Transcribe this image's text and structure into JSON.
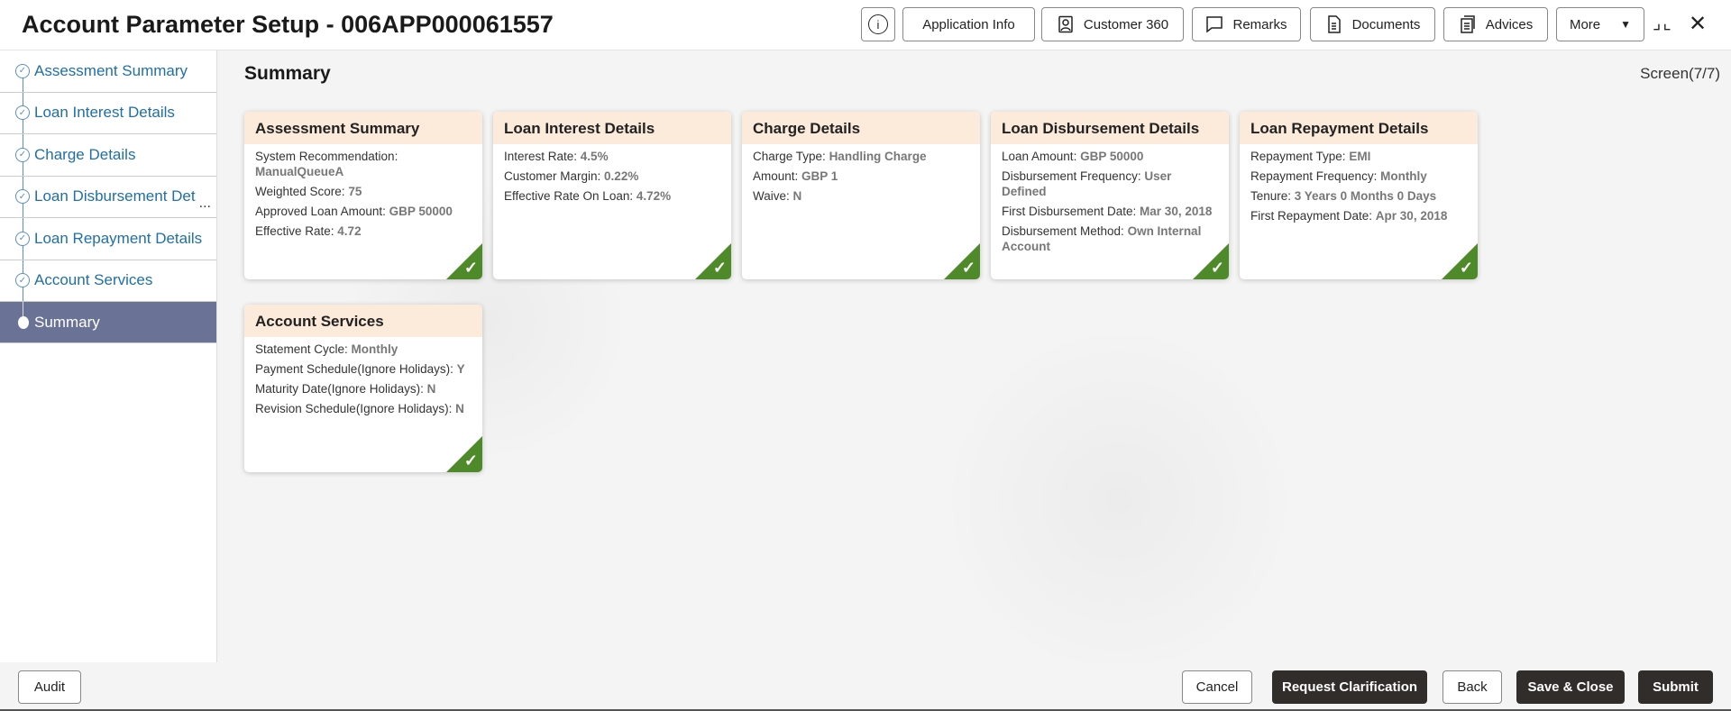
{
  "header": {
    "title": "Account Parameter Setup - 006APP000061557",
    "buttons": [
      {
        "label": "Application Info",
        "icon": "none"
      },
      {
        "label": "Customer 360",
        "icon": "user-icon"
      },
      {
        "label": "Remarks",
        "icon": "comment-icon"
      },
      {
        "label": "Documents",
        "icon": "document-icon"
      },
      {
        "label": "Advices",
        "icon": "advices-icon"
      },
      {
        "label": "More",
        "icon": "chevron-down-icon"
      }
    ]
  },
  "sidebar": {
    "items": [
      {
        "label": "Assessment Summary"
      },
      {
        "label": "Loan Interest Details"
      },
      {
        "label": "Charge Details"
      },
      {
        "label": "Loan Disbursement Det"
      },
      {
        "label": "Loan Repayment Details"
      },
      {
        "label": "Account Services"
      },
      {
        "label": "Summary",
        "active": true
      }
    ],
    "ellipsis": "..."
  },
  "main": {
    "title": "Summary",
    "screen": "Screen(7/7)",
    "cards": [
      {
        "title": "Assessment Summary",
        "rows": [
          {
            "k": "System Recommendation: ",
            "v": "ManualQueueA",
            "block": true
          },
          {
            "k": "Weighted Score: ",
            "v": "75"
          },
          {
            "k": "Approved Loan Amount: ",
            "v": "GBP 50000"
          },
          {
            "k": "Effective Rate: ",
            "v": "4.72"
          }
        ]
      },
      {
        "title": "Loan Interest Details",
        "rows": [
          {
            "k": "Interest Rate: ",
            "v": "4.5%"
          },
          {
            "k": "Customer Margin: ",
            "v": "0.22%"
          },
          {
            "k": "Effective Rate On Loan: ",
            "v": "4.72%"
          }
        ]
      },
      {
        "title": "Charge Details",
        "rows": [
          {
            "k": "Charge Type: ",
            "v": "Handling Charge"
          },
          {
            "k": "Amount: ",
            "v": "GBP 1"
          },
          {
            "k": "Waive: ",
            "v": "N"
          }
        ]
      },
      {
        "title": "Loan Disbursement Details",
        "rows": [
          {
            "k": "Loan Amount: ",
            "v": "GBP 50000"
          },
          {
            "k": "Disbursement Frequency: ",
            "v": "User Defined"
          },
          {
            "k": "First Disbursement Date: ",
            "v": "Mar 30, 2018"
          },
          {
            "k": "Disbursement Method: ",
            "v": "Own Internal Account"
          }
        ]
      },
      {
        "title": "Loan Repayment Details",
        "rows": [
          {
            "k": "Repayment Type: ",
            "v": "EMI"
          },
          {
            "k": "Repayment Frequency: ",
            "v": "Monthly"
          },
          {
            "k": "Tenure: ",
            "v": "3 Years 0 Months 0 Days"
          },
          {
            "k": "First Repayment Date: ",
            "v": "Apr 30, 2018"
          }
        ]
      },
      {
        "title": "Account Services",
        "rows": [
          {
            "k": "Statement Cycle: ",
            "v": "Monthly"
          },
          {
            "k": "Payment Schedule(Ignore Holidays): ",
            "v": "Y"
          },
          {
            "k": "Maturity Date(Ignore Holidays): ",
            "v": "N"
          },
          {
            "k": "Revision Schedule(Ignore Holidays): ",
            "v": "N"
          }
        ]
      }
    ],
    "complete_color": "#4e8a2a"
  },
  "footer": {
    "audit": "Audit",
    "cancel": "Cancel",
    "request_clarification": "Request Clarification",
    "back": "Back",
    "save_close": "Save & Close",
    "submit": "Submit"
  }
}
